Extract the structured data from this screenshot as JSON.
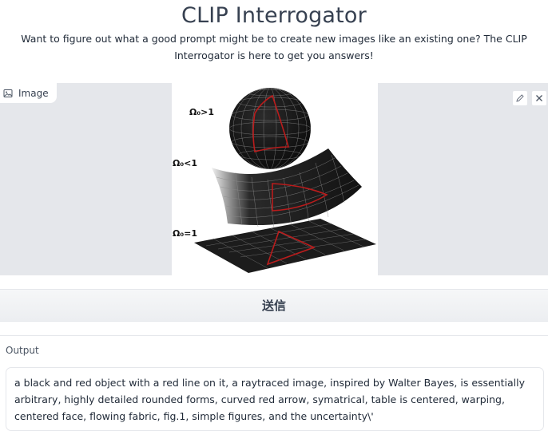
{
  "header": {
    "title": "CLIP Interrogator",
    "description": "Want to figure out what a good prompt might be to create new images like an existing one? The CLIP Interrogator is here to get you answers!"
  },
  "image_panel": {
    "label": "Image",
    "label_icon": "image-icon",
    "edit_icon": "pencil-icon",
    "clear_icon": "close-icon",
    "figure_labels": {
      "closed": "Ω₀>1",
      "open": "Ω₀<1",
      "flat": "Ω₀=1"
    }
  },
  "submit": {
    "label": "送信"
  },
  "output": {
    "label": "Output",
    "text": "a black and red object with a red line on it, a raytraced image, inspired by Walter Bayes, is essentially arbitrary, highly detailed rounded forms, curved red arrow, symatrical, table is centered, warping, centered face, flowing fabric, fig.1, simple figures, and the uncertainty\\'"
  },
  "colors": {
    "panel_bg": "#e5e7eb",
    "grid_red": "#b91c1c",
    "surface_dark": "#1a1a1a"
  }
}
